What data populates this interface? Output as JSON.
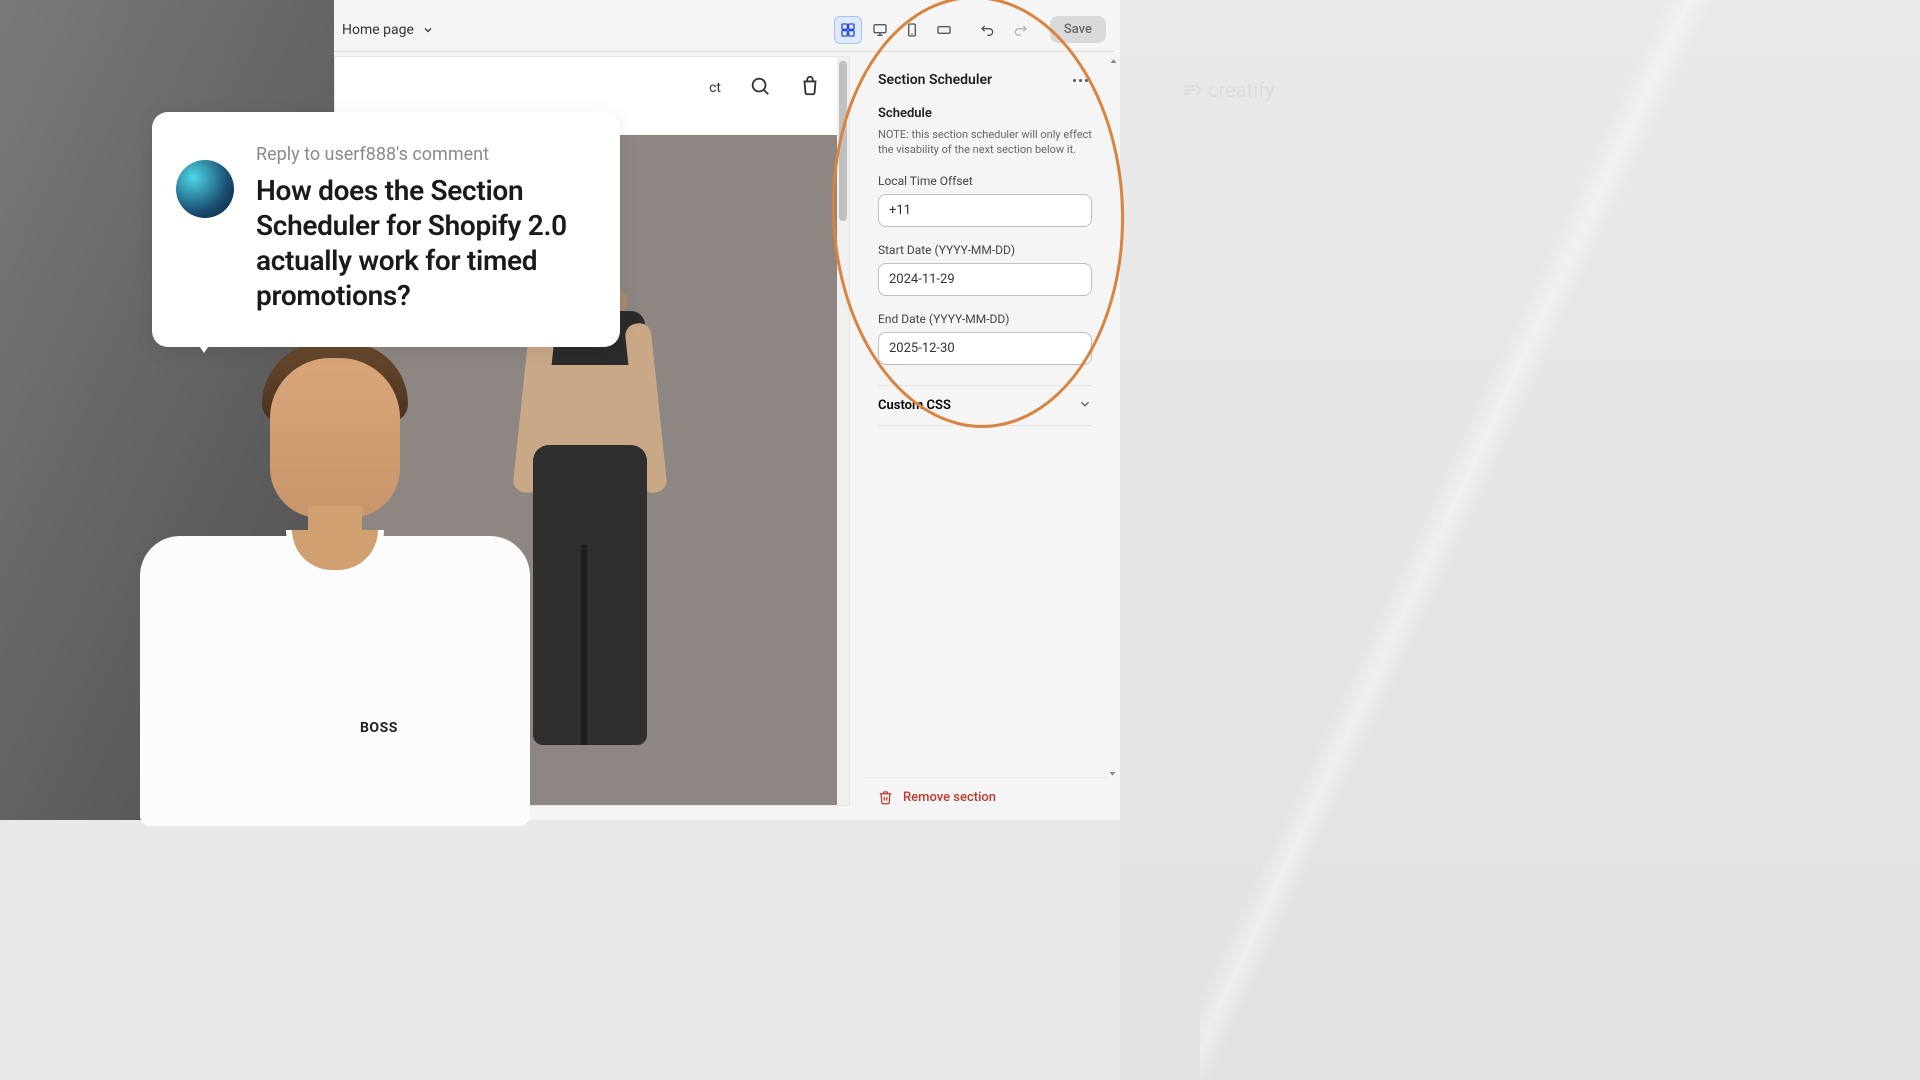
{
  "topbar": {
    "page_label": "Home page",
    "save_label": "Save"
  },
  "preview": {
    "nav_text": "ct"
  },
  "comment": {
    "reply_to": "Reply to userf888's comment",
    "question": "How does the Section Scheduler for Shopify 2.0 actually work for timed promotions?"
  },
  "presenter": {
    "shirt_brand": "BOSS"
  },
  "sidebar": {
    "title": "Section Scheduler",
    "schedule_heading": "Schedule",
    "note": "NOTE: this section scheduler will only effect the visability of the next section below it.",
    "offset_label": "Local Time Offset",
    "offset_value": "+11",
    "start_label": "Start Date (YYYY-MM-DD)",
    "start_value": "2024-11-29",
    "end_label": "End Date (YYYY-MM-DD)",
    "end_value": "2025-12-30",
    "css_label": "Custom CSS",
    "remove_label": "Remove section"
  },
  "watermark": "creatify"
}
